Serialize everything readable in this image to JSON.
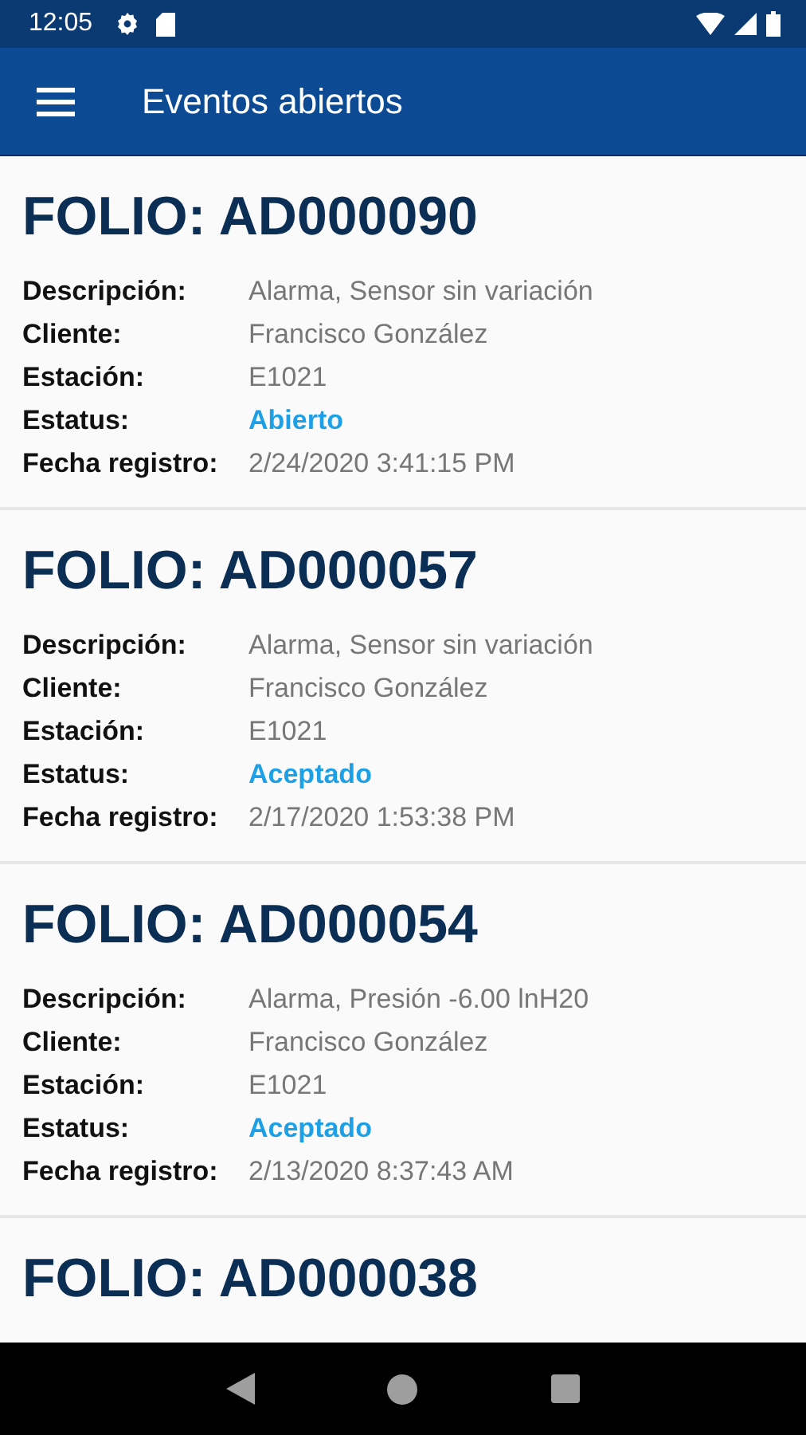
{
  "status_bar": {
    "time": "12:05"
  },
  "app_bar": {
    "title": "Eventos abiertos"
  },
  "events": [
    {
      "folio": "FOLIO: AD000090",
      "fields": [
        {
          "kind": "text",
          "label": "Descripción:",
          "value": "Alarma, Sensor sin variación"
        },
        {
          "kind": "text",
          "label": "Cliente:",
          "value": "Francisco González"
        },
        {
          "kind": "text",
          "label": "Estación:",
          "value": "E1021"
        },
        {
          "kind": "status",
          "label": "Estatus:",
          "value": "Abierto"
        },
        {
          "kind": "text",
          "label": "Fecha registro:",
          "value": "2/24/2020 3:41:15 PM"
        }
      ]
    },
    {
      "folio": "FOLIO: AD000057",
      "fields": [
        {
          "kind": "text",
          "label": "Descripción:",
          "value": "Alarma, Sensor sin variación"
        },
        {
          "kind": "text",
          "label": "Cliente:",
          "value": "Francisco González"
        },
        {
          "kind": "text",
          "label": "Estación:",
          "value": "E1021"
        },
        {
          "kind": "status",
          "label": "Estatus:",
          "value": "Aceptado"
        },
        {
          "kind": "text",
          "label": "Fecha registro:",
          "value": "2/17/2020 1:53:38 PM"
        }
      ]
    },
    {
      "folio": "FOLIO: AD000054",
      "fields": [
        {
          "kind": "text",
          "label": "Descripción:",
          "value": "Alarma, Presión -6.00 lnH20"
        },
        {
          "kind": "text",
          "label": "Cliente:",
          "value": "Francisco González"
        },
        {
          "kind": "text",
          "label": "Estación:",
          "value": "E1021"
        },
        {
          "kind": "status",
          "label": "Estatus:",
          "value": "Aceptado"
        },
        {
          "kind": "text",
          "label": "Fecha registro:",
          "value": "2/13/2020 8:37:43 AM"
        }
      ]
    },
    {
      "folio": "FOLIO: AD000038"
    }
  ]
}
